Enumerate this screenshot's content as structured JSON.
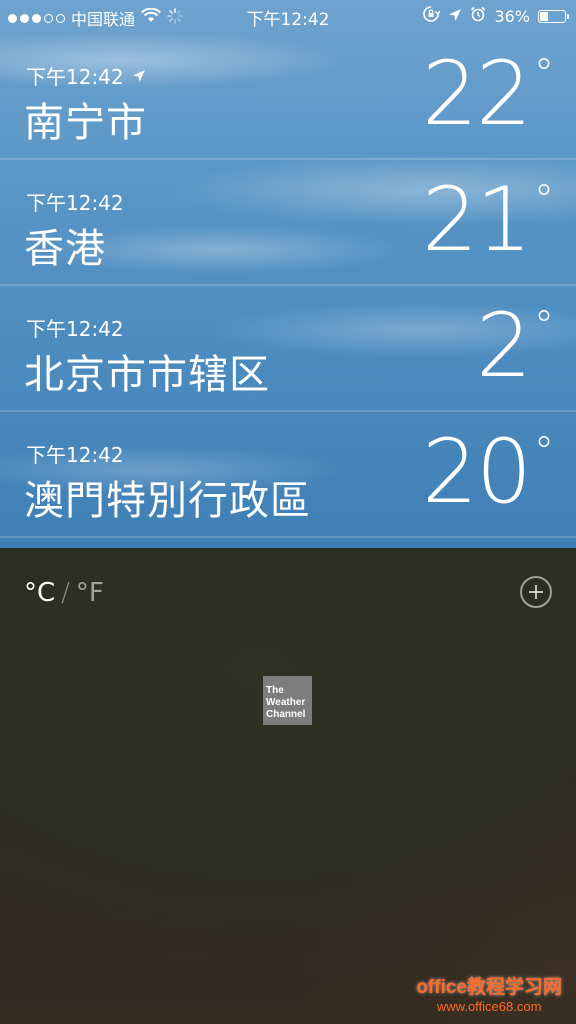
{
  "status_bar": {
    "carrier": "中国联通",
    "time": "下午12:42",
    "battery_text": "36%",
    "battery_level": 0.36,
    "signal_bars_filled": 3,
    "signal_bars_total": 5
  },
  "cities": [
    {
      "time": "下午12:42",
      "name": "南宁市",
      "temp": "22",
      "current_location": true
    },
    {
      "time": "下午12:42",
      "name": "香港",
      "temp": "21",
      "current_location": false
    },
    {
      "time": "下午12:42",
      "name": "北京市市辖区",
      "temp": "2",
      "current_location": false
    },
    {
      "time": "下午12:42",
      "name": "澳門特別行政區",
      "temp": "20",
      "current_location": false
    }
  ],
  "degree_symbol": "°",
  "units": {
    "celsius": "°C",
    "separator": "/",
    "fahrenheit": "°F",
    "selected": "celsius"
  },
  "logo": {
    "line1": "The",
    "line2": "Weather",
    "line3": "Channel"
  },
  "watermark": {
    "line1": "office教程学习网",
    "line2": "www.office68.com"
  },
  "colors": {
    "sky": "#4e8dc0",
    "bottom": "#2b2c24",
    "watermark": "#ff6a2a"
  }
}
